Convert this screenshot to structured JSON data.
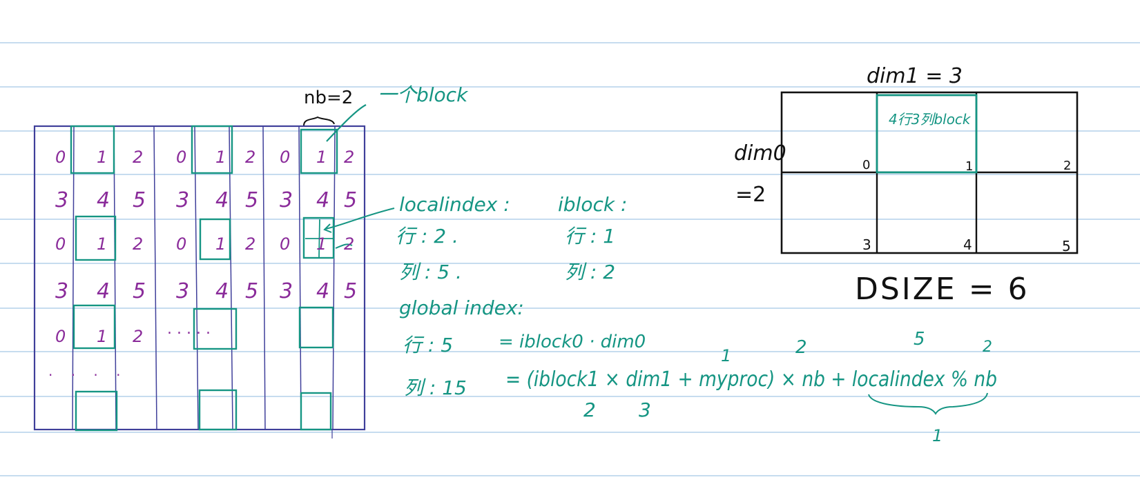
{
  "colors": {
    "paper_lines": "#c6dcef",
    "grid_ink": "#3f3f9a",
    "block_ink": "#159583",
    "purple_ink": "#8a2b9a",
    "annotation_ink": "#159583",
    "black_ink": "#111111"
  },
  "left_grid": {
    "nb_label": "nb=2",
    "block_label": "一个block",
    "rows": [
      [
        "0",
        "1",
        "2",
        "0",
        "1",
        "2",
        "0",
        "1",
        "2"
      ],
      [
        "3",
        "4",
        "5",
        "3",
        "4",
        "5",
        "3",
        "4",
        "5"
      ],
      [
        "0",
        "1",
        "2",
        "0",
        "1",
        "2",
        "0",
        "1",
        "2"
      ],
      [
        "3",
        "4",
        "5",
        "3",
        "4",
        "5",
        "3",
        "4",
        "5"
      ],
      [
        "0",
        "1",
        "2",
        "",
        "",
        "",
        "",
        "",
        ""
      ]
    ],
    "row5_dots": ". . . . .",
    "row6_dots": ". . . ."
  },
  "notes": {
    "localindex_title": "localindex :",
    "localindex_row": "行 : 2 .",
    "localindex_col": "列 : 5 .",
    "iblock_title": "iblock :",
    "iblock_row": "行 : 1",
    "iblock_col": "列 : 2",
    "global_title": "global index:",
    "global_row": "行 : 5",
    "global_row_formula": "= iblock0 · dim0",
    "global_col": "列 : 15",
    "global_col_formula": "= (iblock1 × dim1 + myproc) × nb + localindex % nb",
    "num_over_myproc": "1",
    "num_over_nb": "2",
    "num_over_localindex": "5",
    "num_over_nb2": "2",
    "num_under_iblock1": "2",
    "num_under_dim1": "3",
    "num_under_brace": "1"
  },
  "proc_grid": {
    "dim1_label": "dim1 = 3",
    "dim0_label": "dim0",
    "dim0_value": "=2",
    "block_text": "4行3列block",
    "cells": [
      "0",
      "1",
      "2",
      "3",
      "4",
      "5"
    ],
    "dsize_label": "DSIZE = 6"
  }
}
